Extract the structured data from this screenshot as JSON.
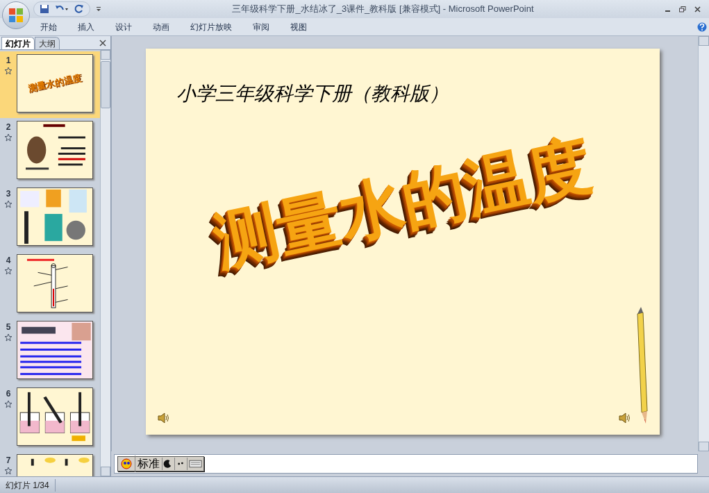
{
  "window": {
    "title": "三年级科学下册_水结冰了_3课件_教科版 [兼容模式] - Microsoft PowerPoint"
  },
  "ribbon_tabs": [
    {
      "label": "开始"
    },
    {
      "label": "插入"
    },
    {
      "label": "设计"
    },
    {
      "label": "动画"
    },
    {
      "label": "幻灯片放映"
    },
    {
      "label": "审阅"
    },
    {
      "label": "视图"
    }
  ],
  "pane_tabs": [
    {
      "label": "幻灯片",
      "selected": true
    },
    {
      "label": "大纲",
      "selected": false
    }
  ],
  "thumbnails": [
    {
      "number": "1",
      "selected": true,
      "kind": "title",
      "title": "测量水的温度"
    },
    {
      "number": "2",
      "selected": false,
      "kind": "portrait"
    },
    {
      "number": "3",
      "selected": false,
      "kind": "instruments"
    },
    {
      "number": "4",
      "selected": false,
      "kind": "diagram"
    },
    {
      "number": "5",
      "selected": false,
      "kind": "list"
    },
    {
      "number": "6",
      "selected": false,
      "kind": "beakers"
    },
    {
      "number": "7",
      "selected": false,
      "kind": "partial"
    }
  ],
  "slide": {
    "subtitle": "小学三年级科学下册（教科版）",
    "title": "测量水的温度"
  },
  "ime": {
    "mode": "标准"
  },
  "status_bar": {
    "slide_counter": "幻灯片 1/34"
  }
}
